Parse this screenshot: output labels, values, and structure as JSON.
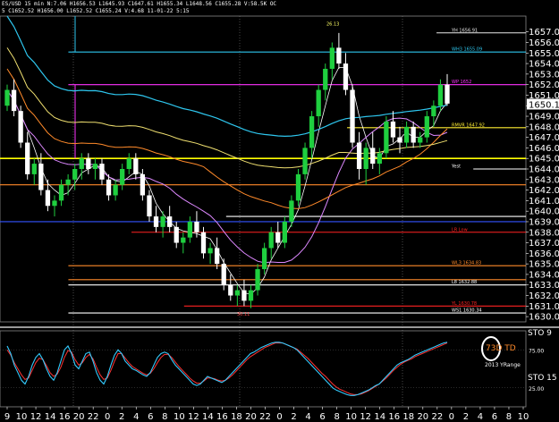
{
  "header": {
    "line1": "ES/USD 15 min  N:7.06  H1656.53  L1645.93  C1647.61  H1655.34  L1648.56  C1655.28  V:58.5K  OC",
    "line2": "5  C1652.52  H1656.00  L1652.52  C1655.24  V:4.68  11-01-22  5:15"
  },
  "chart_data": [
    {
      "type": "candlestick",
      "y_ticks": [
        "1657.00",
        "1656.00",
        "1655.00",
        "1654.00",
        "1653.00",
        "1652.00",
        "1651.00",
        "1650.00",
        "1649.00",
        "1648.00",
        "1647.00",
        "1646.00",
        "1645.00",
        "1644.00",
        "1643.00",
        "1642.00",
        "1641.00",
        "1640.00",
        "1639.00",
        "1638.00",
        "1637.00",
        "1636.00",
        "1635.00",
        "1634.00",
        "1633.00",
        "1632.00",
        "1631.00",
        "1630.00"
      ],
      "ylim": [
        1629.5,
        1658.5
      ],
      "current_price": "1650.15",
      "candles": [
        [
          1650.0,
          1652.0,
          1649.5,
          1651.5
        ],
        [
          1651.5,
          1652.5,
          1649.0,
          1649.5
        ],
        [
          1649.5,
          1650.0,
          1646.0,
          1646.5
        ],
        [
          1646.5,
          1647.5,
          1643.0,
          1643.5
        ],
        [
          1643.5,
          1645.0,
          1642.5,
          1644.5
        ],
        [
          1644.5,
          1645.5,
          1641.5,
          1642.0
        ],
        [
          1642.0,
          1643.0,
          1640.0,
          1640.5
        ],
        [
          1640.5,
          1641.5,
          1639.5,
          1641.0
        ],
        [
          1641.0,
          1643.0,
          1640.5,
          1642.5
        ],
        [
          1642.5,
          1643.5,
          1641.5,
          1643.0
        ],
        [
          1643.0,
          1644.5,
          1642.0,
          1644.0
        ],
        [
          1644.0,
          1645.5,
          1643.0,
          1645.0
        ],
        [
          1645.0,
          1645.5,
          1643.5,
          1644.0
        ],
        [
          1644.0,
          1645.0,
          1643.0,
          1644.5
        ],
        [
          1644.5,
          1645.0,
          1642.5,
          1643.0
        ],
        [
          1643.0,
          1643.5,
          1641.0,
          1641.5
        ],
        [
          1641.5,
          1643.0,
          1641.0,
          1642.5
        ],
        [
          1642.5,
          1644.5,
          1642.0,
          1644.0
        ],
        [
          1644.0,
          1645.5,
          1643.5,
          1645.0
        ],
        [
          1645.0,
          1645.5,
          1643.0,
          1643.5
        ],
        [
          1643.5,
          1644.0,
          1641.0,
          1641.5
        ],
        [
          1641.5,
          1642.0,
          1639.0,
          1639.5
        ],
        [
          1639.5,
          1640.5,
          1638.0,
          1638.5
        ],
        [
          1638.5,
          1640.0,
          1637.5,
          1639.5
        ],
        [
          1639.5,
          1640.5,
          1638.0,
          1638.5
        ],
        [
          1638.5,
          1639.0,
          1636.5,
          1637.0
        ],
        [
          1637.0,
          1638.0,
          1636.0,
          1637.5
        ],
        [
          1637.5,
          1639.5,
          1637.0,
          1639.0
        ],
        [
          1639.0,
          1640.0,
          1637.5,
          1638.0
        ],
        [
          1638.0,
          1638.5,
          1635.5,
          1636.0
        ],
        [
          1636.0,
          1637.0,
          1635.0,
          1636.5
        ],
        [
          1636.5,
          1637.5,
          1634.5,
          1635.0
        ],
        [
          1635.0,
          1635.5,
          1632.5,
          1633.0
        ],
        [
          1633.0,
          1634.0,
          1631.5,
          1632.0
        ],
        [
          1632.0,
          1633.0,
          1631.0,
          1632.5
        ],
        [
          1632.5,
          1633.5,
          1631.0,
          1631.5
        ],
        [
          1631.5,
          1633.0,
          1630.8,
          1632.5
        ],
        [
          1632.5,
          1635.0,
          1632.0,
          1634.5
        ],
        [
          1634.5,
          1637.0,
          1634.0,
          1636.5
        ],
        [
          1636.5,
          1638.5,
          1635.5,
          1638.0
        ],
        [
          1638.0,
          1639.0,
          1636.5,
          1637.0
        ],
        [
          1637.0,
          1639.5,
          1636.5,
          1639.0
        ],
        [
          1639.0,
          1641.5,
          1638.5,
          1641.0
        ],
        [
          1641.0,
          1644.0,
          1640.5,
          1643.5
        ],
        [
          1643.5,
          1646.5,
          1643.0,
          1646.0
        ],
        [
          1646.0,
          1649.5,
          1645.0,
          1649.0
        ],
        [
          1649.0,
          1652.0,
          1648.0,
          1651.5
        ],
        [
          1651.5,
          1654.0,
          1650.5,
          1653.5
        ],
        [
          1653.5,
          1656.0,
          1652.5,
          1655.5
        ],
        [
          1655.5,
          1656.9,
          1653.5,
          1654.0
        ],
        [
          1654.0,
          1655.0,
          1651.0,
          1651.5
        ],
        [
          1651.5,
          1652.0,
          1646.0,
          1646.5
        ],
        [
          1646.5,
          1647.5,
          1643.0,
          1644.0
        ],
        [
          1644.0,
          1646.5,
          1642.5,
          1646.0
        ],
        [
          1646.0,
          1647.5,
          1644.0,
          1644.5
        ],
        [
          1644.5,
          1646.0,
          1643.5,
          1645.5
        ],
        [
          1645.5,
          1649.0,
          1645.0,
          1648.5
        ],
        [
          1648.5,
          1649.5,
          1646.5,
          1647.0
        ],
        [
          1647.0,
          1648.0,
          1645.5,
          1646.5
        ],
        [
          1646.5,
          1648.5,
          1646.0,
          1648.0
        ],
        [
          1648.0,
          1648.5,
          1646.0,
          1646.5
        ],
        [
          1646.5,
          1647.5,
          1646.0,
          1647.0
        ],
        [
          1647.0,
          1649.5,
          1646.5,
          1649.0
        ],
        [
          1649.0,
          1650.5,
          1648.0,
          1650.0
        ],
        [
          1650.0,
          1652.5,
          1649.5,
          1652.0
        ],
        [
          1652.0,
          1653.0,
          1650.0,
          1650.2
        ]
      ],
      "levels": [
        {
          "price": 1656.91,
          "color": "#e8e8e8",
          "start": 0.83,
          "label": "YH 1656.91"
        },
        {
          "price": 1655.09,
          "color": "#2ec6ee",
          "start": 0.13,
          "label": "WH3 1655.09"
        },
        {
          "price": 1652.0,
          "color": "#ff33ff",
          "start": 0.13,
          "label": "WP 1652"
        },
        {
          "price": 1647.92,
          "color": "#ffee33",
          "start": 0.66,
          "label": "RMVR 1647.92"
        },
        {
          "price": 1645.0,
          "color": "#ffff00",
          "start": 0.0,
          "label": ""
        },
        {
          "price": 1644.0,
          "color": "#ffffff",
          "start": 0.9,
          "label": "Yest"
        },
        {
          "price": 1642.5,
          "color": "#ff8a2a",
          "start": 0.0,
          "label": ""
        },
        {
          "price": 1639.5,
          "color": "#ffffff",
          "start": 0.43,
          "label": ""
        },
        {
          "price": 1639.0,
          "color": "#3355ff",
          "start": 0.0,
          "label": ""
        },
        {
          "price": 1638.0,
          "color": "#ff2222",
          "start": 0.25,
          "label": "LR Low"
        },
        {
          "price": 1634.83,
          "color": "#ff8a2a",
          "start": 0.13,
          "label": "WL3 1634.83"
        },
        {
          "price": 1633.5,
          "color": "#ff8a2a",
          "start": 0.13,
          "label": ""
        },
        {
          "price": 1633.0,
          "color": "#ffffff",
          "start": 0.13,
          "label": "L8 1632.88"
        },
        {
          "price": 1631.0,
          "color": "#ff2222",
          "start": 0.35,
          "label": "YL 1630.78"
        },
        {
          "price": 1630.34,
          "color": "#ffffff",
          "start": 0.13,
          "label": "WS1 1630.34"
        }
      ],
      "annotations": [
        {
          "label": "26.13",
          "color": "#ffff66"
        },
        {
          "label": "30.11",
          "color": "#ff4444"
        }
      ]
    },
    {
      "type": "line",
      "title": "STO 9",
      "title2": "STO 15",
      "y_ticks": [
        "25.00",
        "75.00"
      ],
      "ylim": [
        0,
        100
      ],
      "series_fast": [
        80,
        70,
        55,
        45,
        35,
        30,
        40,
        55,
        65,
        70,
        62,
        50,
        40,
        35,
        45,
        60,
        75,
        80,
        70,
        55,
        50,
        60,
        70,
        72,
        60,
        45,
        35,
        30,
        40,
        55,
        68,
        75,
        70,
        60,
        55,
        50,
        48,
        45,
        42,
        40,
        45,
        55,
        65,
        70,
        72,
        70,
        62,
        55,
        50,
        45,
        40,
        35,
        30,
        28,
        30,
        35,
        40,
        38,
        36,
        34,
        32,
        35,
        40,
        45,
        50,
        55,
        60,
        65,
        70,
        72,
        75,
        78,
        80,
        82,
        84,
        85,
        85,
        84,
        82,
        80,
        78,
        75,
        70,
        65,
        60,
        55,
        50,
        45,
        40,
        35,
        30,
        25,
        22,
        20,
        18,
        16,
        15,
        15,
        16,
        18,
        20,
        22,
        25,
        28,
        30,
        35,
        40,
        45,
        50,
        55,
        58,
        60,
        62,
        65,
        68,
        70,
        72,
        74,
        76,
        78,
        80,
        82,
        84,
        85
      ],
      "series_slow": [
        75,
        68,
        58,
        50,
        42,
        36,
        38,
        48,
        58,
        64,
        62,
        54,
        45,
        40,
        43,
        52,
        65,
        74,
        72,
        62,
        55,
        58,
        65,
        69,
        63,
        52,
        42,
        36,
        38,
        48,
        60,
        70,
        70,
        64,
        58,
        53,
        50,
        47,
        44,
        42,
        44,
        50,
        58,
        65,
        69,
        69,
        65,
        59,
        53,
        48,
        43,
        38,
        34,
        31,
        31,
        34,
        38,
        38,
        37,
        35,
        34,
        35,
        38,
        42,
        47,
        52,
        57,
        62,
        66,
        69,
        72,
        75,
        78,
        80,
        82,
        84,
        84,
        84,
        82,
        80,
        78,
        76,
        72,
        68,
        64,
        59,
        54,
        49,
        44,
        40,
        35,
        30,
        26,
        23,
        21,
        19,
        17,
        16,
        16,
        17,
        19,
        21,
        24,
        27,
        30,
        34,
        38,
        43,
        48,
        52,
        56,
        59,
        61,
        63,
        66,
        68,
        70,
        72,
        74,
        76,
        78,
        80,
        82,
        84
      ]
    }
  ],
  "x_ticks": [
    "9",
    "10",
    "12",
    "14",
    "16",
    "20",
    "22",
    "0",
    "2",
    "4",
    "6",
    "8",
    "10",
    "12",
    "14",
    "16",
    "18",
    "20",
    "22",
    "0",
    "2",
    "4",
    "6",
    "8",
    "10",
    "12",
    "14",
    "16",
    "18",
    "20",
    "22",
    "0",
    "2",
    "4",
    "6",
    "8",
    "10"
  ],
  "legend_marker": "73D TD",
  "legend_caption": "2013 YRange",
  "colors": {
    "bull_candle": "#1fcf3f",
    "bear_candle": "#ffffff",
    "cyan_ma": "#2ec6ee",
    "yellow_ma": "#f0e070",
    "orange_ma": "#ff8a2a",
    "violet_ma": "#dd88ff",
    "white_ma": "#ffffff",
    "sto_fast": "#33ccff",
    "sto_slow": "#ff3333"
  }
}
